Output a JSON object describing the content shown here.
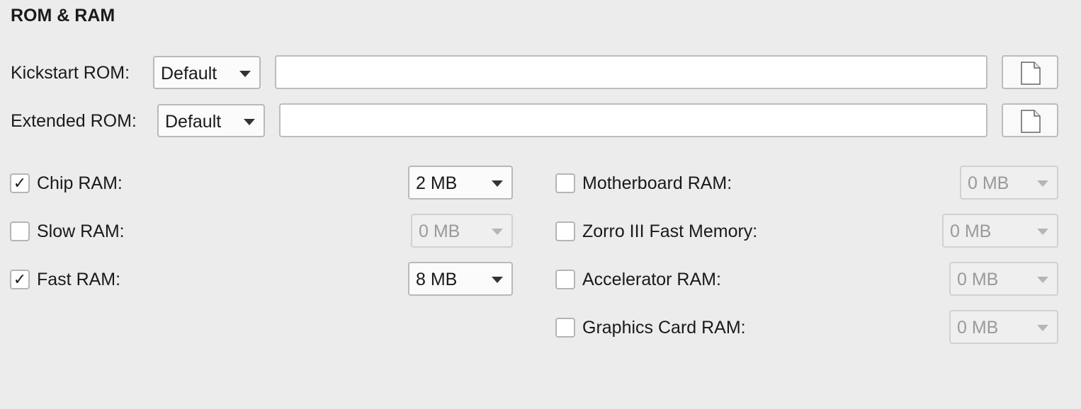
{
  "section": {
    "title": "ROM & RAM"
  },
  "rom": {
    "kickstart": {
      "label": "Kickstart ROM:",
      "selected": "Default",
      "path": ""
    },
    "extended": {
      "label": "Extended ROM:",
      "selected": "Default",
      "path": ""
    }
  },
  "ram_left": [
    {
      "label": "Chip RAM:",
      "checked": true,
      "value": "2 MB",
      "enabled": true
    },
    {
      "label": "Slow RAM:",
      "checked": false,
      "value": "0 MB",
      "enabled": false
    },
    {
      "label": "Fast RAM:",
      "checked": true,
      "value": "8 MB",
      "enabled": true
    }
  ],
  "ram_right": [
    {
      "label": "Motherboard RAM:",
      "checked": false,
      "value": "0 MB",
      "enabled": false
    },
    {
      "label": "Zorro III Fast Memory:",
      "checked": false,
      "value": "0 MB",
      "enabled": false
    },
    {
      "label": "Accelerator RAM:",
      "checked": false,
      "value": "0 MB",
      "enabled": false
    },
    {
      "label": "Graphics Card RAM:",
      "checked": false,
      "value": "0 MB",
      "enabled": false
    }
  ],
  "checkmark_glyph": "✓",
  "icons": {
    "browse": "document-icon",
    "dropdown": "chevron-down-icon"
  }
}
